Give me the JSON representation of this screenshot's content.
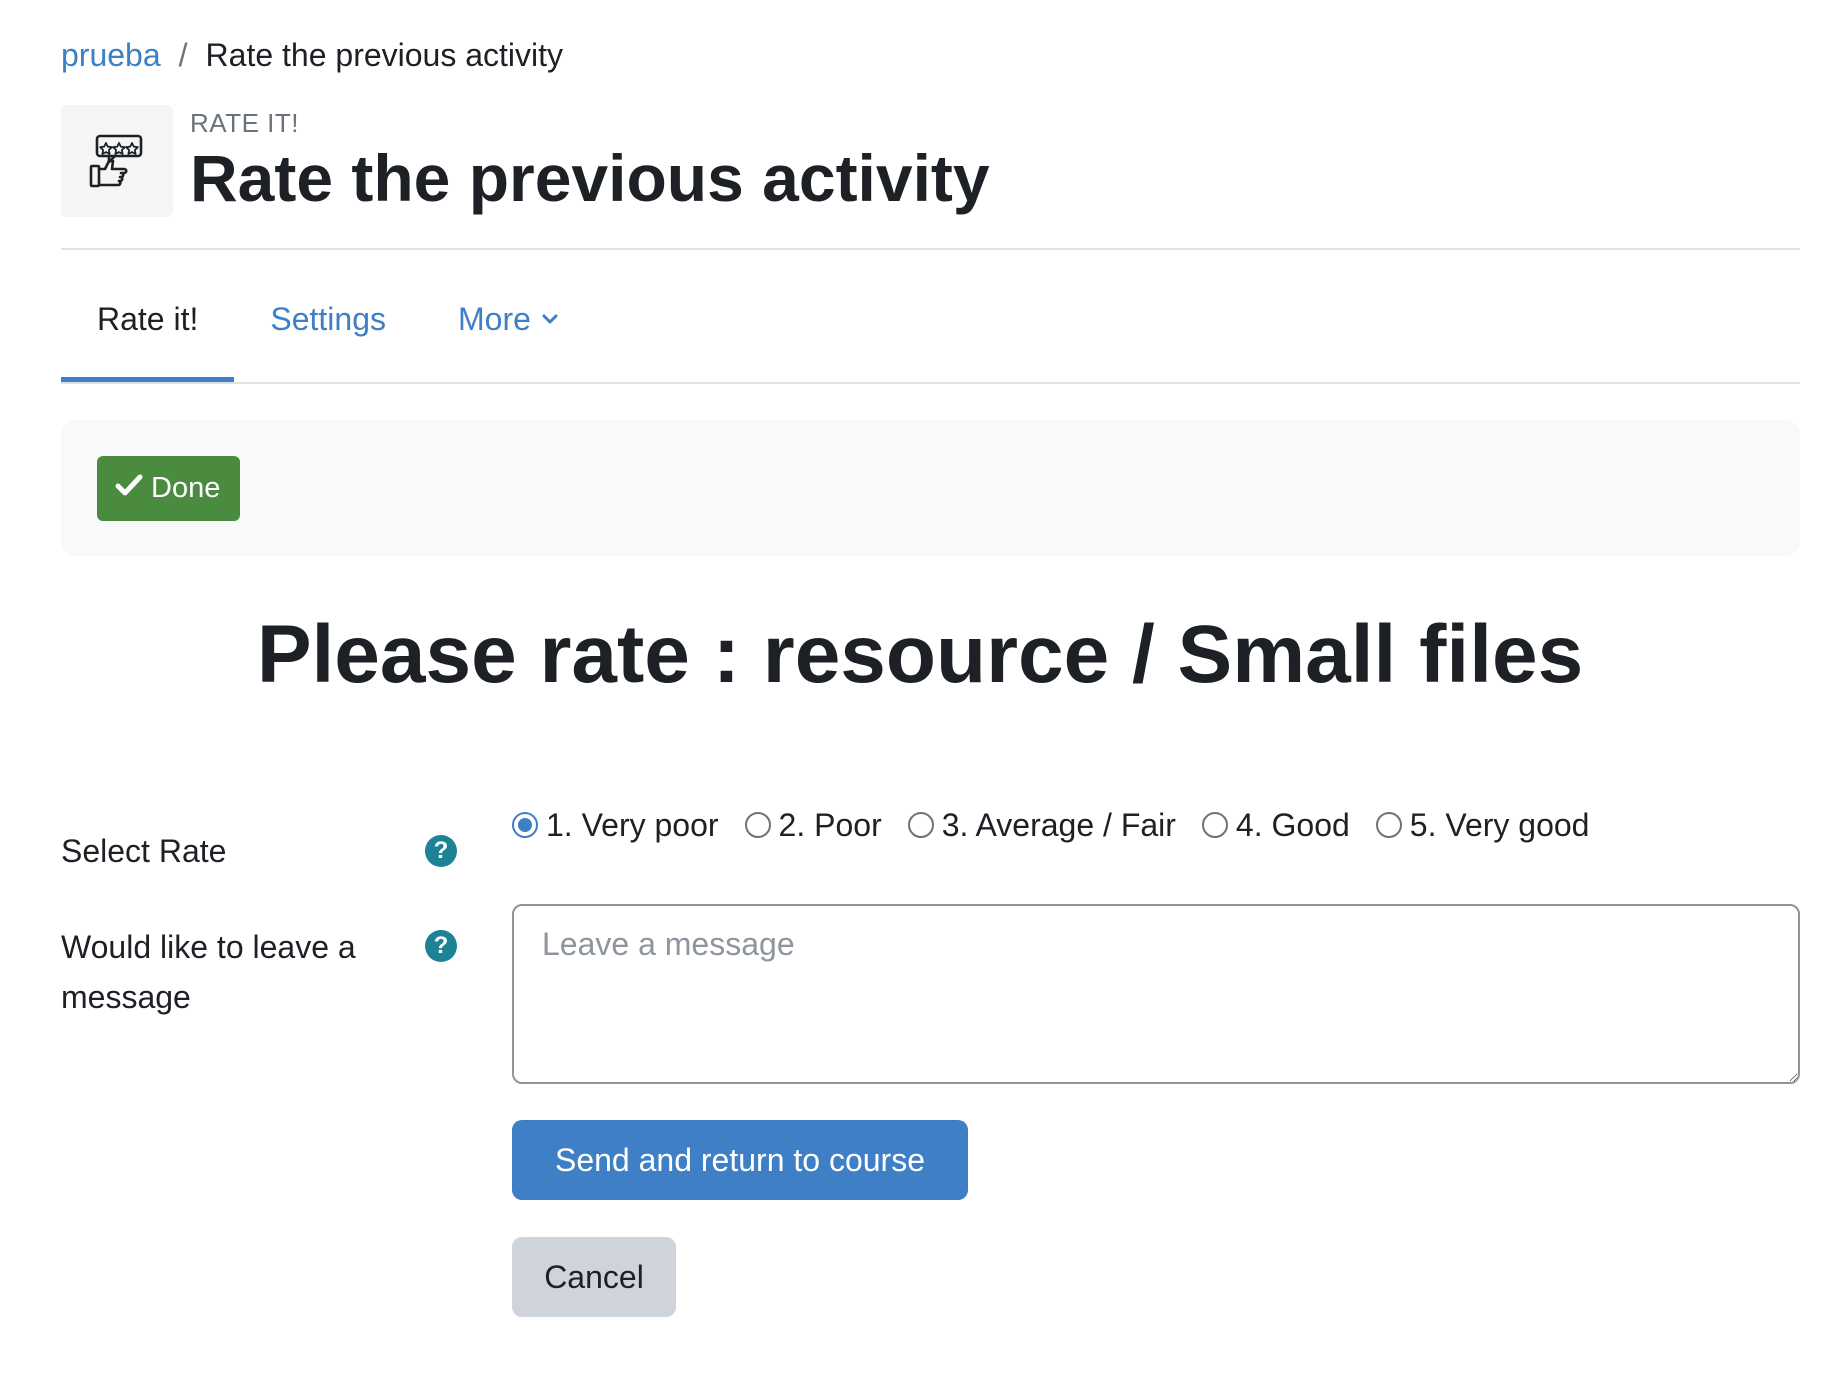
{
  "breadcrumb": {
    "course": "prueba",
    "separator": "/",
    "current": "Rate the previous activity"
  },
  "header": {
    "icon": "rate-it-activity-icon",
    "pretitle": "RATE IT!",
    "title": "Rate the previous activity"
  },
  "tabs": [
    {
      "label": "Rate it!",
      "active": true
    },
    {
      "label": "Settings",
      "active": false
    },
    {
      "label": "More",
      "active": false,
      "icon": "chevron-down-icon"
    }
  ],
  "completion": {
    "label": "Done",
    "icon": "check-icon",
    "color": "#4b8b3f"
  },
  "main": {
    "heading": "Please rate : resource / Small files"
  },
  "form": {
    "rate": {
      "label": "Select Rate",
      "help_icon": "question-circle-icon",
      "selected": "1",
      "options": [
        {
          "value": "1",
          "label": "1. Very poor"
        },
        {
          "value": "2",
          "label": "2. Poor"
        },
        {
          "value": "3",
          "label": "3. Average / Fair"
        },
        {
          "value": "4",
          "label": "4. Good"
        },
        {
          "value": "5",
          "label": "5. Very good"
        }
      ]
    },
    "message": {
      "label_line1": "Would like to leave a",
      "label_line2": "message",
      "help_icon": "question-circle-icon",
      "placeholder": "Leave a message",
      "value": ""
    },
    "submit_label": "Send and return to course",
    "cancel_label": "Cancel"
  },
  "colors": {
    "accent": "#3e7fc6",
    "success": "#4b8b3f",
    "help": "#1d8294",
    "text": "#1d2125"
  }
}
